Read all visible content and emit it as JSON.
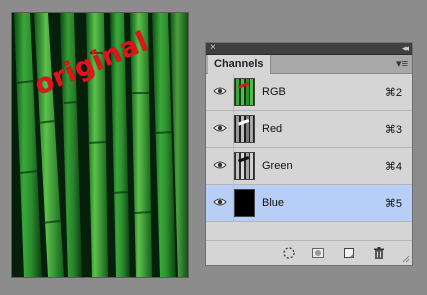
{
  "canvas": {
    "overlay_text": "original"
  },
  "panel": {
    "close_glyph": "×",
    "collapse_glyph": "◂◂",
    "tab_title": "Channels",
    "menu_glyph": "▾≡",
    "channels": [
      {
        "label": "RGB",
        "shortcut": "⌘2",
        "selected": false,
        "thumb": "color"
      },
      {
        "label": "Red",
        "shortcut": "⌘3",
        "selected": false,
        "thumb": "gray-light"
      },
      {
        "label": "Green",
        "shortcut": "⌘4",
        "selected": false,
        "thumb": "gray-mid"
      },
      {
        "label": "Blue",
        "shortcut": "⌘5",
        "selected": true,
        "thumb": "black"
      }
    ],
    "footer_icons": [
      "load-selection-icon",
      "save-selection-icon",
      "new-channel-icon",
      "trash-icon"
    ]
  },
  "colors": {
    "selected_row": "#b7cff6",
    "overlay_text": "#e1131d"
  }
}
